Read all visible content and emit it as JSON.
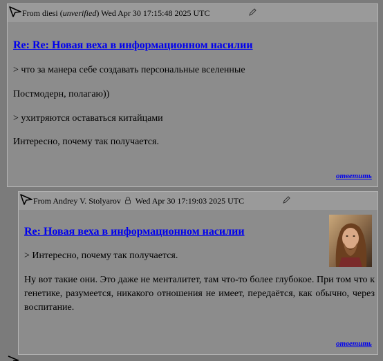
{
  "comments": [
    {
      "from_prefix": "From",
      "author": "diesi",
      "author_note": "unverified",
      "date": "Wed Apr 30 17:15:48 2025 UTC",
      "subject": "Re: Re: Новая веха в информационном насилии",
      "paragraphs": [
        "> что за манера себе создавать персональные вселенные",
        "Постмодерн, полагаю))",
        "> ухитряются оставаться китайцами",
        "Интересно, почему так получается."
      ],
      "reply_label": "ответить"
    },
    {
      "from_prefix": "From",
      "author": "Andrey V. Stolyarov",
      "date": "Wed Apr 30 17:19:03 2025 UTC",
      "subject": "Re: Новая веха в информационном насилии",
      "paragraphs": [
        "> Интересно, почему так получается.",
        "Ну вот такие они. Это даже не менталитет, там что-то более глубокое. При том что к генетике, разумеется, никакого отношения не имеет, передаётся, как обычно, через воспитание."
      ],
      "reply_label": "ответить"
    }
  ],
  "icons": {
    "thread": "pointer-arrow-icon",
    "edit": "pencil-icon",
    "verified": "lock-icon"
  },
  "colors": {
    "page_bg": "#7b7b7b",
    "comment_bg": "#8c8c8c",
    "header_bg": "#9a9a9a",
    "link": "#0000ee"
  }
}
